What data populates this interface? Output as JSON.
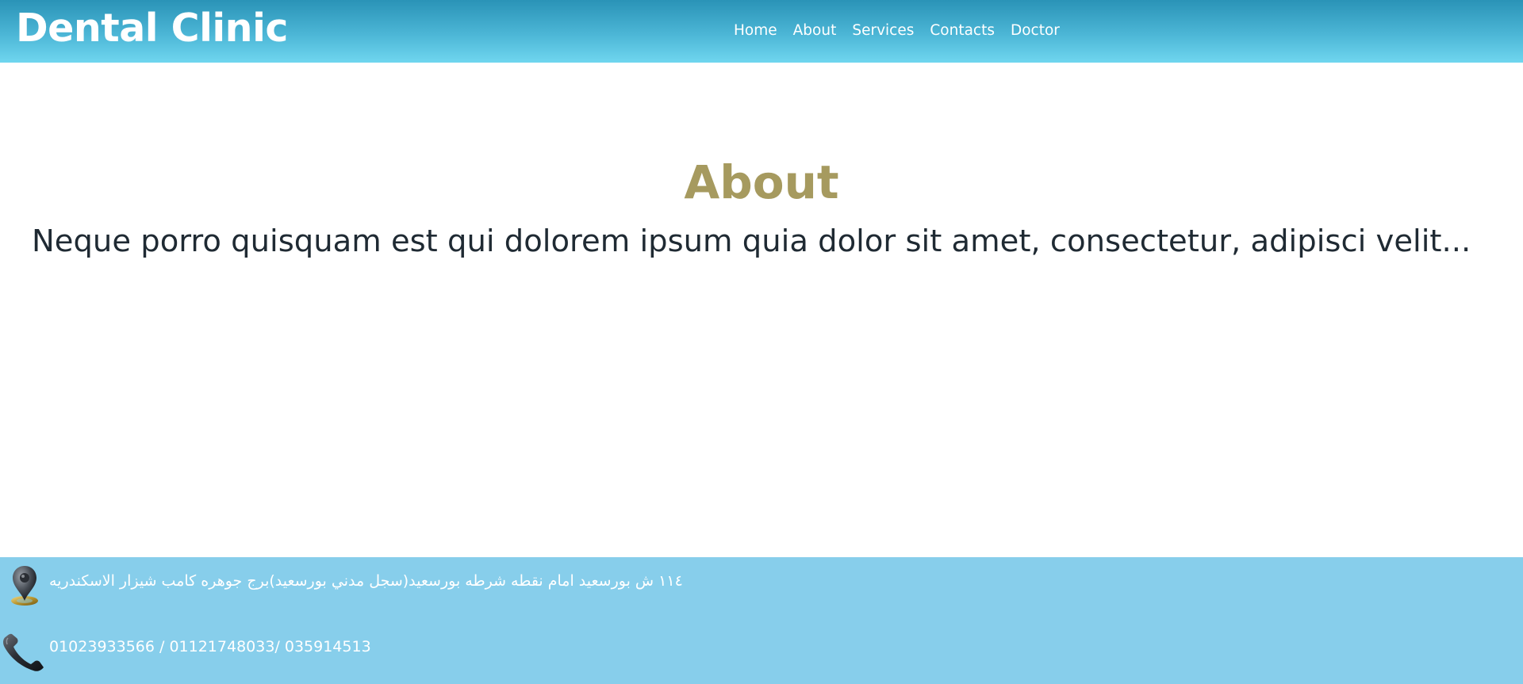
{
  "header": {
    "brand": "Dental Clinic",
    "nav": [
      {
        "label": "Home"
      },
      {
        "label": "About"
      },
      {
        "label": "Services"
      },
      {
        "label": "Contacts"
      },
      {
        "label": "Doctor"
      }
    ]
  },
  "main": {
    "title": "About",
    "text": "Neque porro quisquam est qui dolorem ipsum quia dolor sit amet, consectetur, adipisci velit..."
  },
  "footer": {
    "address": "١١٤ ش بورسعيد امام نقطه شرطه بورسعيد(سجل مدني بورسعيد)برج جوهره كامب شيزار الاسكندريه",
    "address_icon": "location-pin-icon",
    "phones": "01023933566 / 01121748033/ 035914513",
    "phone_icon": "telephone-handset-icon"
  },
  "colors": {
    "header_gradient_top": "#2a93b7",
    "header_gradient_bottom": "#6fd6ef",
    "title": "#a69a5f",
    "footer_background": "#87ceeb"
  }
}
